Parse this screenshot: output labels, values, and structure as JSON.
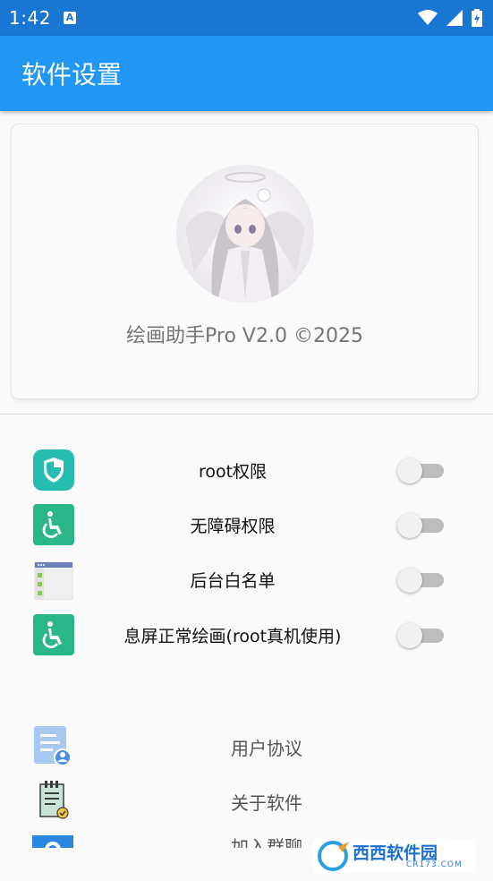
{
  "status_bar": {
    "time": "1:42",
    "app_icon_letter": "A",
    "icons": [
      "wifi-icon",
      "signal-icon",
      "battery-icon"
    ]
  },
  "app_bar": {
    "title": "软件设置",
    "color": "#2196f3"
  },
  "card": {
    "version_text": "绘画助手Pro V2.0 ©2025"
  },
  "permissions": [
    {
      "label": "root权限",
      "icon": "shield-icon",
      "enabled": false
    },
    {
      "label": "无障碍权限",
      "icon": "accessibility-icon",
      "enabled": false
    },
    {
      "label": "后台白名单",
      "icon": "app-window-icon",
      "enabled": false
    },
    {
      "label": "息屏正常绘画(root真机使用)",
      "icon": "accessibility-icon",
      "enabled": false
    }
  ],
  "menu": [
    {
      "label": "用户协议",
      "icon": "user-agreement-icon"
    },
    {
      "label": "关于软件",
      "icon": "clipboard-check-icon"
    },
    {
      "label": "加入群聊",
      "icon": "group-chat-icon"
    }
  ],
  "watermark": {
    "brand": "西西软件园",
    "url": "CR173.COM"
  },
  "colors": {
    "accent": "#2196f3",
    "teal": "#26b98f",
    "switch_off_track": "#bdbdbd"
  }
}
